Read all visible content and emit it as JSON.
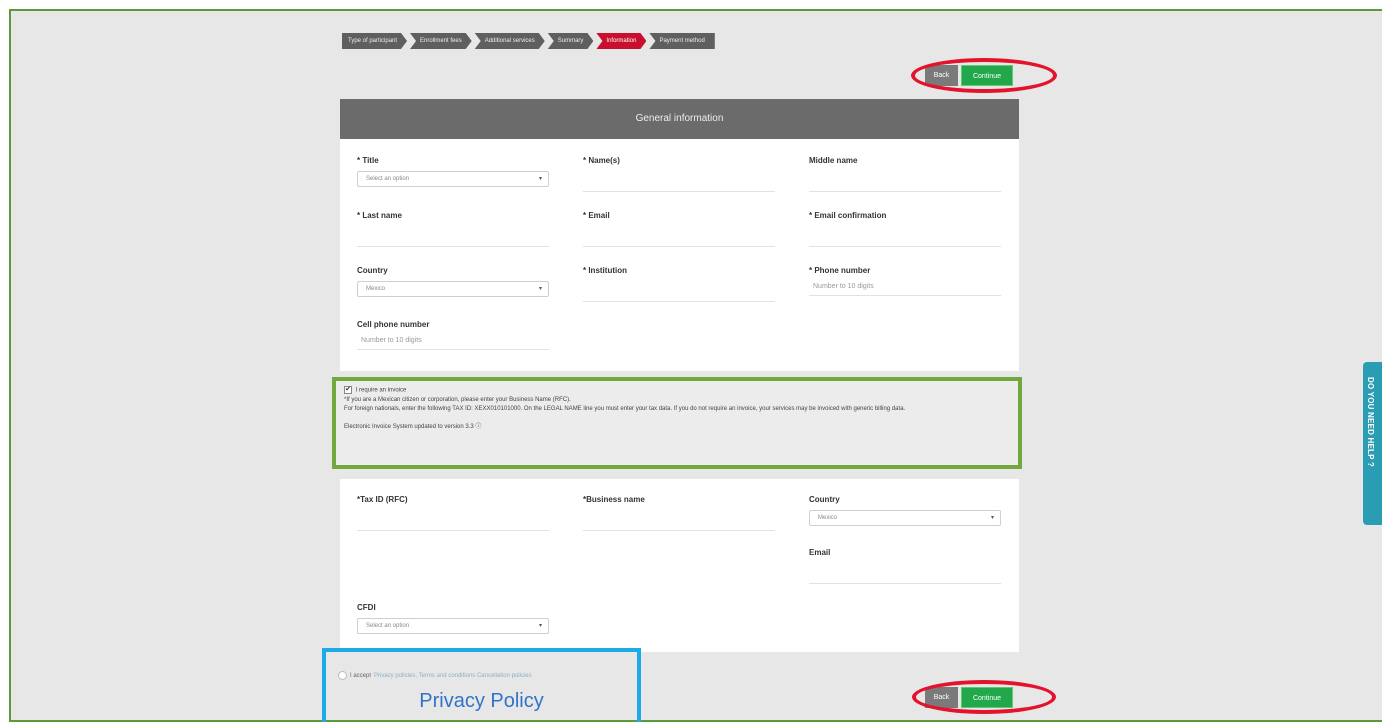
{
  "steps": [
    "Type of participant",
    "Enrollment fees",
    "Additional services",
    "Summary",
    "Information",
    "Payment method"
  ],
  "buttons": {
    "back": "Back",
    "continue": "Continue"
  },
  "general": {
    "header": "General information",
    "title": {
      "label": "* Title",
      "value": "Select an option"
    },
    "names": {
      "label": "* Name(s)"
    },
    "middle_name": {
      "label": "Middle name"
    },
    "last_name": {
      "label": "* Last name"
    },
    "email": {
      "label": "* Email"
    },
    "email_confirm": {
      "label": "* Email confirmation"
    },
    "country": {
      "label": "Country",
      "value": "Mexico"
    },
    "institution": {
      "label": "* Institution"
    },
    "phone": {
      "label": "* Phone number",
      "placeholder": "Number to 10 digits"
    },
    "cell_phone": {
      "label": "Cell phone number",
      "placeholder": "Number to 10 digits"
    }
  },
  "invoice": {
    "checkbox_label": "I require an invoice",
    "line1": "*If you are a Mexican citizen or corporation, please enter your Business Name (RFC).",
    "line2": "For foreign nationals, enter the following TAX ID: XEXX010101000. On the LEGAL NAME line you must enter your tax data. If you do not require an invoice, your services may be invoiced with generic billing data.",
    "line3": "Electronic Invoice System updated to version 3.3 ⓘ"
  },
  "billing": {
    "tax_id": {
      "label": "*Tax ID (RFC)"
    },
    "business_name": {
      "label": "*Business name"
    },
    "country": {
      "label": "Country",
      "value": "Mexico"
    },
    "email": {
      "label": "Email"
    },
    "cfdi": {
      "label": "CFDI",
      "value": "Select an option"
    }
  },
  "accept": {
    "prefix": "I accept",
    "links": "Privacy policies, Terms and conditions Cancellation policies"
  },
  "annotation": {
    "privacy_policy": "Privacy Policy"
  },
  "help": {
    "label": "DO YOU NEED HELP ?"
  },
  "colors": {
    "active_step": "#c8102e",
    "continue": "#22a84a",
    "highlight_ring": "#e3132b",
    "notice_border": "#72a83f",
    "privacy_box": "#1ea9e8",
    "help_tab": "#2a9db5"
  }
}
